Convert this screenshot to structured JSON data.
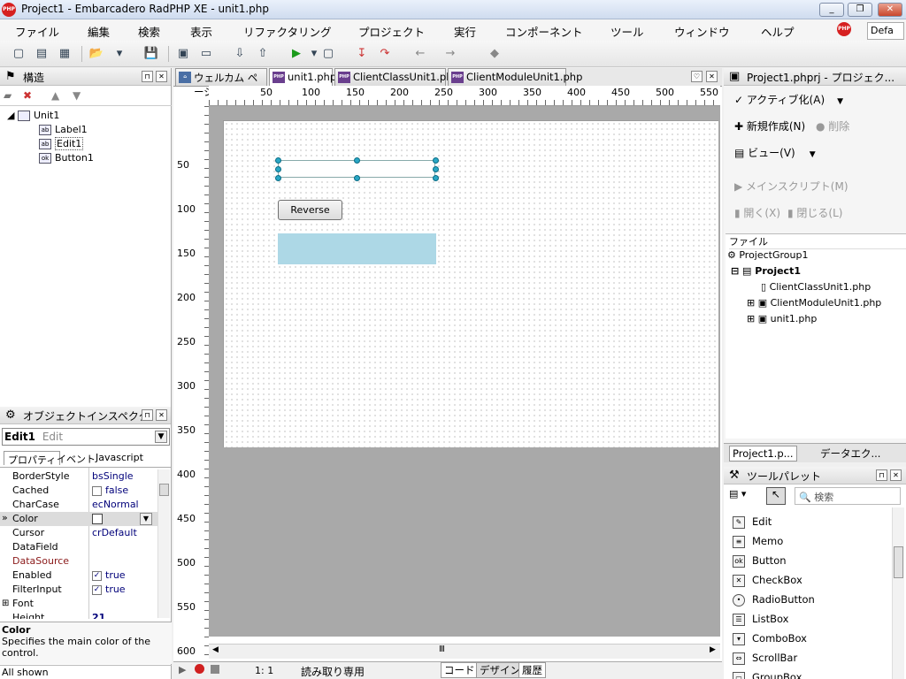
{
  "window": {
    "title": "Project1 - Embarcadero RadPHP XE - unit1.php",
    "logo": "PHP"
  },
  "menu": [
    "ファイル",
    "編集",
    "検索",
    "表示",
    "リファクタリング",
    "プロジェクト",
    "実行",
    "コンポーネント",
    "ツール",
    "ウィンドウ",
    "ヘルプ"
  ],
  "toolbar": {
    "layout_value": "Defa"
  },
  "structure": {
    "title": "構造",
    "tree": {
      "root": "Unit1",
      "children": [
        "Label1",
        "Edit1",
        "Button1"
      ]
    }
  },
  "inspector": {
    "title": "オブジェクトインスペクタ",
    "object_name": "Edit1",
    "object_type": "Edit",
    "tabs": [
      "プロパティ",
      "イベント",
      "Javascript"
    ],
    "properties": [
      {
        "name": "BorderStyle",
        "value": "bsSingle"
      },
      {
        "name": "Cached",
        "value": "false",
        "checkbox": true,
        "checked": false
      },
      {
        "name": "CharCase",
        "value": "ecNormal"
      },
      {
        "name": "Color",
        "value": ""
      },
      {
        "name": "Cursor",
        "value": "crDefault"
      },
      {
        "name": "DataField",
        "value": ""
      },
      {
        "name": "DataSource",
        "value": ""
      },
      {
        "name": "Enabled",
        "value": "true",
        "checkbox": true,
        "checked": true
      },
      {
        "name": "FilterInput",
        "value": "true",
        "checkbox": true,
        "checked": true
      },
      {
        "name": "Font",
        "value": ""
      },
      {
        "name": "Height",
        "value": "21"
      }
    ],
    "help_title": "Color",
    "help_text": "Specifies the main color of the control.",
    "status": "All shown"
  },
  "editor": {
    "tabs": [
      "ウェルカム ページ",
      "unit1.php",
      "ClientClassUnit1.php",
      "ClientModuleUnit1.php"
    ],
    "hruler": [
      "50",
      "100",
      "150",
      "200",
      "250",
      "300",
      "350",
      "400",
      "450",
      "500",
      "550"
    ],
    "vruler": [
      "50",
      "100",
      "150",
      "200",
      "250",
      "300",
      "350",
      "400",
      "450",
      "500",
      "550",
      "600"
    ],
    "button_caption": "Reverse",
    "cursor_pos": "1: 1",
    "mode": "読み取り専用",
    "view_tabs": [
      "コード",
      "デザイン",
      "履歴"
    ]
  },
  "project": {
    "title": "Project1.phprj - プロジェク...",
    "actions": [
      {
        "label": "アクティブ化(A)",
        "enabled": true
      },
      {
        "label": "新規作成(N)",
        "enabled": true
      },
      {
        "label": "削除",
        "enabled": false
      },
      {
        "label": "ビュー(V)",
        "enabled": true
      },
      {
        "label": "メインスクリプト(M)",
        "enabled": false
      },
      {
        "label": "開く(X)",
        "enabled": false
      },
      {
        "label": "閉じる(L)",
        "enabled": false
      }
    ],
    "file_header": "ファイル",
    "files": [
      {
        "label": "ProjectGroup1"
      },
      {
        "label": "Project1"
      },
      {
        "label": "ClientClassUnit1.php"
      },
      {
        "label": "ClientModuleUnit1.php"
      },
      {
        "label": "unit1.php"
      }
    ],
    "bottom_tabs": [
      "Project1.p...",
      "データエク..."
    ]
  },
  "palette": {
    "title": "ツールパレット",
    "search_placeholder": "検索",
    "items": [
      "Edit",
      "Memo",
      "Button",
      "CheckBox",
      "RadioButton",
      "ListBox",
      "ComboBox",
      "ScrollBar",
      "GroupBox"
    ]
  }
}
